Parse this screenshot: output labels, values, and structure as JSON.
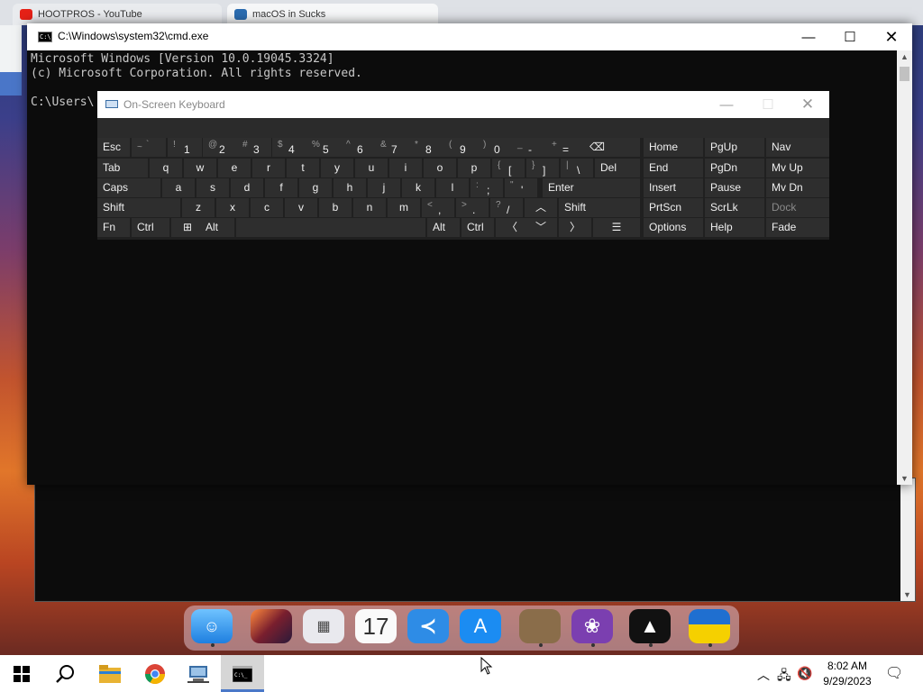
{
  "browser_bg": {
    "tabs": [
      {
        "label": "HOOTPROS - YouTube"
      },
      {
        "label": "macOS in Sucks"
      }
    ]
  },
  "cmd": {
    "title": "C:\\Windows\\system32\\cmd.exe",
    "lines": [
      "Microsoft Windows [Version 10.0.19045.3324]",
      "(c) Microsoft Corporation. All rights reserved.",
      "",
      "C:\\Users\\"
    ]
  },
  "osk": {
    "title": "On-Screen Keyboard",
    "rows": {
      "r1": [
        "Esc",
        "~",
        "`",
        "!",
        "1",
        "@",
        "2",
        "#",
        "3",
        "$",
        "4",
        "%",
        "5",
        "^",
        "6",
        "&",
        "7",
        "*",
        "8",
        "(",
        "9",
        ")",
        "0",
        "_",
        "-",
        "+",
        "="
      ],
      "r2": [
        "Tab",
        "q",
        "w",
        "e",
        "r",
        "t",
        "y",
        "u",
        "i",
        "o",
        "p",
        "{",
        "[",
        "}",
        "]",
        "|",
        "\\",
        "Del"
      ],
      "r3": [
        "Caps",
        "a",
        "s",
        "d",
        "f",
        "g",
        "h",
        "j",
        "k",
        "l",
        ":",
        ";",
        "\"",
        "'",
        "Enter"
      ],
      "r4": [
        "Shift",
        "z",
        "x",
        "c",
        "v",
        "b",
        "n",
        "m",
        "<",
        ",",
        ">",
        ".",
        "?",
        "/",
        "Shift"
      ],
      "r5": [
        "Fn",
        "Ctrl",
        "Alt",
        "Alt",
        "Ctrl"
      ]
    },
    "nav": {
      "home": "Home",
      "pgup": "PgUp",
      "nav": "Nav",
      "end": "End",
      "pgdn": "PgDn",
      "mvup": "Mv Up",
      "insert": "Insert",
      "pause": "Pause",
      "mvdn": "Mv Dn",
      "prtscn": "PrtScn",
      "scrlk": "ScrLk",
      "dock": "Dock",
      "options": "Options",
      "help": "Help",
      "fade": "Fade"
    }
  },
  "dock": {
    "calendar_day": "17"
  },
  "taskbar": {
    "time": "8:02 AM",
    "date": "9/29/2023",
    "icons": [
      "windows-start-icon",
      "search-icon",
      "file-explorer-icon",
      "chrome-icon",
      "network-app-icon",
      "cmd-icon"
    ]
  },
  "colors": {
    "osk_key": "#2e2e2e",
    "osk_bg": "#202020",
    "console_text": "#c8c8c8",
    "taskbar_active": "#4a78c8"
  }
}
